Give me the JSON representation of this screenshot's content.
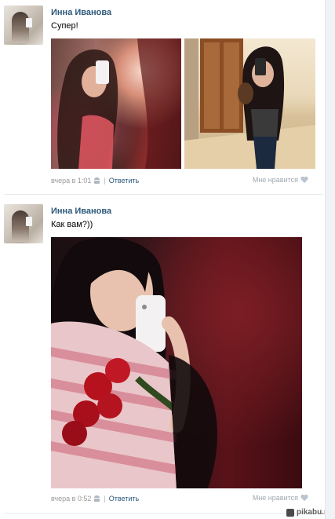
{
  "posts": [
    {
      "author": "Инна Иванова",
      "text": "Супер!",
      "time": "вчера в 1:01",
      "reply_label": "Ответить",
      "like_label": "Мне нравится"
    },
    {
      "author": "Инна Иванова",
      "text": "Как вам?))",
      "time": "вчера в 0:52",
      "reply_label": "Ответить",
      "like_label": "Мне нравится"
    }
  ],
  "icons": {
    "platform": "android-icon",
    "like": "heart-icon"
  },
  "colors": {
    "link": "#2b587a",
    "meta": "#999999",
    "like_icon": "#b9c4d0"
  },
  "watermark": "pikabu.ru"
}
